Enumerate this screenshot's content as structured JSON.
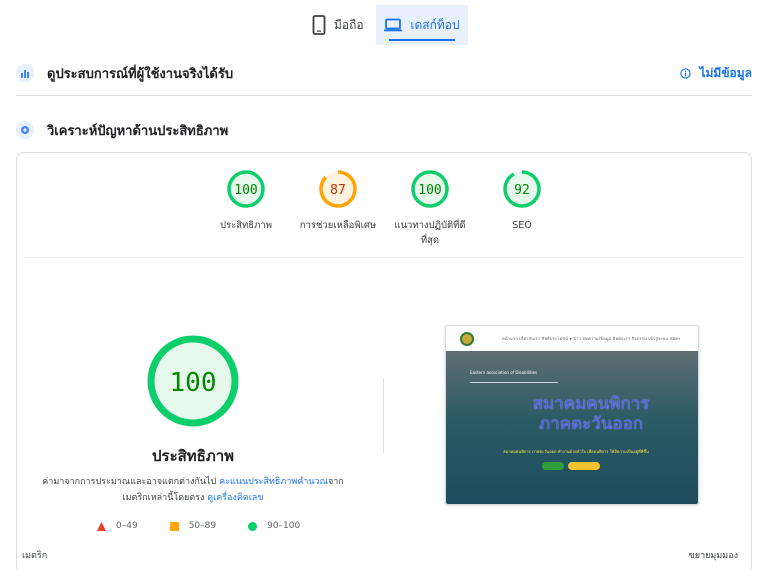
{
  "tabs": {
    "mobile": {
      "label": "มือถือ",
      "icon": "smartphone-icon"
    },
    "desktop": {
      "label": "เดสก์ท็อป",
      "icon": "laptop-icon",
      "selected": true
    }
  },
  "crux": {
    "title": "ดูประสบการณ์ที่ผู้ใช้งานจริงได้รับ",
    "no_data": "ไม่มีข้อมูล",
    "icon": "users-chart-icon"
  },
  "diagnose": {
    "title": "วิเคราะห์ปัญหาด้านประสิทธิภาพ",
    "icon": "lighthouse-icon"
  },
  "scores": [
    {
      "label": "ประสิทธิภาพ",
      "score": "100",
      "value": 100,
      "status": "pass"
    },
    {
      "label": "การช่วยเหลือพิเศษ",
      "score": "87",
      "value": 87,
      "status": "average"
    },
    {
      "label_line1": "แนวทางปฏิบัติที่ดี",
      "label_line2": "ที่สุด",
      "score": "100",
      "value": 100,
      "status": "pass"
    },
    {
      "label": "SEO",
      "score": "92",
      "value": 92,
      "status": "pass"
    }
  ],
  "main": {
    "score": "100",
    "value": 100,
    "title": "ประสิทธิภาพ",
    "desc_1": "ค่ามาจากการประมาณและอาจแตกต่างกันไป ",
    "desc_link1": "คะแนนประสิทธิภาพคำนวณ",
    "desc_2": "จาก",
    "desc_3": "เมตริกเหล่านี้โดยตรง ",
    "desc_link2": "ดูเครื่องคิดเลข"
  },
  "legend": [
    {
      "range": "0–49",
      "color": "#eb3c2f",
      "shape": "triangle"
    },
    {
      "range": "50–89",
      "color": "#ffa400",
      "shape": "square"
    },
    {
      "range": "90–100",
      "color": "#0cce6b",
      "shape": "circle"
    }
  ],
  "thumbnail": {
    "nav": "หน้าแรก   เกี่ยวกับเรา   สิทธิประโยชน์ ▾   ข่าว   บทความ/ข้อมูล   ติดต่อเรา   กิจกรรม   เข้าสู่ระบบ   สมัคร",
    "subtitle": "Eastern association of Disabilities",
    "headline_1": "สมาคมคนพิการ",
    "headline_2": "ภาคตะวันออก",
    "caption": "สมาคมคนพิการ ภาคตะวันออก ทำงานด้วยหัวใจ เพื่อคนพิการ ให้มีความเป็นอยู่ที่ดีขึ้น"
  },
  "footer": {
    "metrics": "เมตริก",
    "expand": "ขยายมุมมอง"
  },
  "colors": {
    "pass": "#0cce6b",
    "pass_fill": "#e6f7ec",
    "pass_text": "#008800",
    "average": "#ffa400",
    "average_fill": "#fff3e0",
    "average_text": "#c33300",
    "link": "#1a73e8"
  }
}
